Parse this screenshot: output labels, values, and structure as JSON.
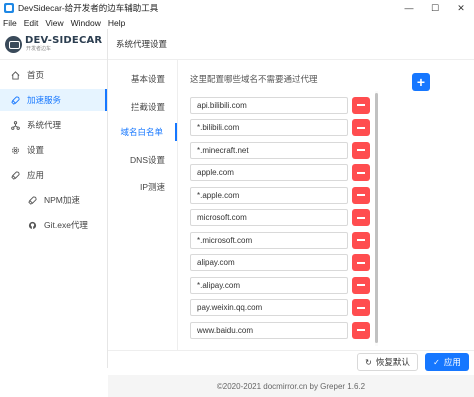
{
  "window": {
    "title": "DevSidecar-给开发者的边车辅助工具",
    "controls": [
      "minimize",
      "maximize",
      "close"
    ]
  },
  "menu": [
    "File",
    "Edit",
    "View",
    "Window",
    "Help"
  ],
  "sidebar": {
    "logo_main": "DEV-SIDECAR",
    "logo_sub": "开发者边车",
    "items": [
      {
        "label": "首页",
        "icon": "home-icon"
      },
      {
        "label": "加速服务",
        "icon": "rocket-icon",
        "active": true
      },
      {
        "label": "系统代理",
        "icon": "share-icon"
      },
      {
        "label": "设置",
        "icon": "gear-icon"
      },
      {
        "label": "应用",
        "icon": "rocket-icon"
      },
      {
        "label": "NPM加速",
        "icon": "rocket-icon"
      },
      {
        "label": "Git.exe代理",
        "icon": "github-icon"
      }
    ]
  },
  "main": {
    "page_title": "系统代理设置",
    "tabs": [
      "基本设置",
      "拦截设置",
      "域名白名单",
      "DNS设置",
      "IP测速"
    ],
    "active_tab": "域名白名单",
    "hint": "这里配置哪些域名不需要通过代理",
    "domains": [
      "api.bilibili.com",
      "*.bilibili.com",
      "*.minecraft.net",
      "apple.com",
      "*.apple.com",
      "microsoft.com",
      "*.microsoft.com",
      "alipay.com",
      "*.alipay.com",
      "pay.weixin.qq.com",
      "www.baidu.com"
    ],
    "restore_label": "恢复默认",
    "apply_label": "应用"
  },
  "footer": "©2020-2021 docmirror.cn by Greper 1.6.2",
  "colors": {
    "primary": "#1677ff",
    "danger": "#ff4d4f",
    "active_bg": "#e6f4ff"
  }
}
